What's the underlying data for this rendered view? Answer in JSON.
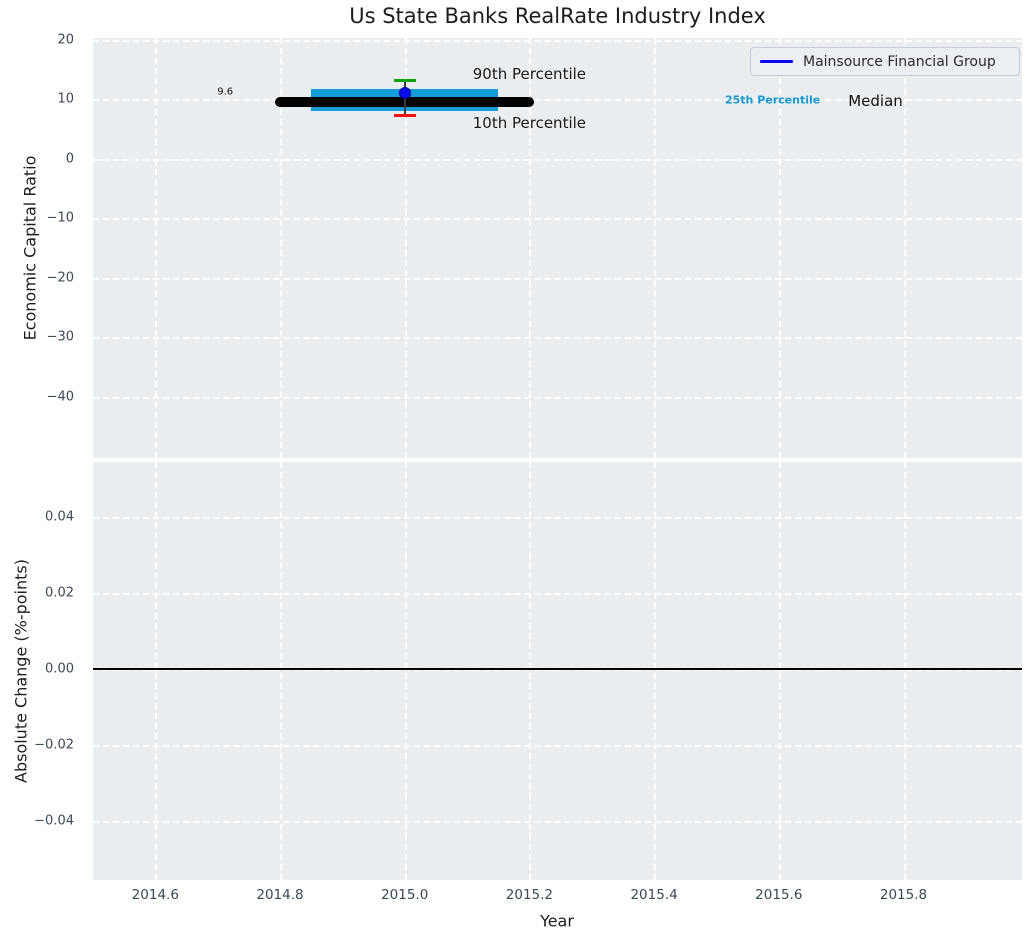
{
  "figure": {
    "background": "#ffffff",
    "panel_background": "#ebeef0",
    "grid_color": "#ffffff",
    "tick_color": "#3b4856"
  },
  "chart_data": {
    "type": "line",
    "title": "Us State Banks RealRate Industry Index",
    "xlabel": "Year",
    "xlim": [
      2014.5,
      2015.99
    ],
    "xticks": {
      "values": [
        2014.6,
        2014.8,
        2015.0,
        2015.2,
        2015.4,
        2015.6,
        2015.8
      ],
      "labels": [
        "2014.6",
        "2014.8",
        "2015.0",
        "2015.2",
        "2015.4",
        "2015.6",
        "2015.8"
      ]
    },
    "legend": {
      "position": "upper right",
      "entries": [
        {
          "label": "Mainsource Financial Group",
          "color": "#0b0bf0"
        }
      ]
    },
    "panels": [
      {
        "id": "economic-capital-ratio",
        "ylabel": "Economic Capital Ratio",
        "ylim": [
          -50.3,
          20.3
        ],
        "yticks": {
          "values": [
            20,
            10,
            0,
            -10,
            -20,
            -30,
            -40
          ],
          "labels": [
            "20",
            "10",
            "0",
            "−10",
            "−20",
            "−30",
            "−40"
          ]
        },
        "series": [
          {
            "name": "Mainsource Financial Group",
            "marker": "circle",
            "color": "#0b0bf0",
            "edge_color": "#000090",
            "x": [
              2015.0
            ],
            "y": [
              11.1
            ]
          }
        ],
        "industry_stats": {
          "median_value": 9.6,
          "median_label": "9.6",
          "median_span": [
            2014.8,
            2015.2
          ],
          "median_color": "#000000",
          "p25": 8.0,
          "p75": 11.7,
          "band_span": [
            2014.85,
            2015.15
          ],
          "band_color": "#149cd8",
          "p90": 13.1,
          "p10": 7.2,
          "whisker_x": 2015.0,
          "p90_color": "#0da30d",
          "p10_color": "#f50f0f",
          "stem_color": "#3a3a3a"
        },
        "annotations": [
          {
            "text": "90th Percentile",
            "x": 2015.2,
            "y": 14.3,
            "color": "#1a1a1a",
            "size": 15,
            "bold": false
          },
          {
            "text": "10th Percentile",
            "x": 2015.2,
            "y": 6.1,
            "color": "#1a1a1a",
            "size": 15,
            "bold": false
          },
          {
            "text": "25th Percentile",
            "x": 2015.59,
            "y": 9.9,
            "color": "#1499d3",
            "size": 11,
            "bold": true
          },
          {
            "text": "Median",
            "x": 2015.755,
            "y": 9.7,
            "color": "#111111",
            "size": 15,
            "bold": false
          },
          {
            "text": "9.6",
            "x": 2014.712,
            "y": 11.2,
            "color": "#111111",
            "size": 10,
            "bold": false
          }
        ]
      },
      {
        "id": "absolute-change",
        "ylabel": "Absolute Change (%-points)",
        "ylim": [
          -0.0555,
          0.0545
        ],
        "yticks": {
          "values": [
            0.04,
            0.02,
            0.0,
            -0.02,
            -0.04
          ],
          "labels": [
            "0.04",
            "0.02",
            "0.00",
            "−0.02",
            "−0.04"
          ]
        },
        "zero_line": {
          "y": 0.0,
          "color": "#000000"
        }
      }
    ]
  }
}
